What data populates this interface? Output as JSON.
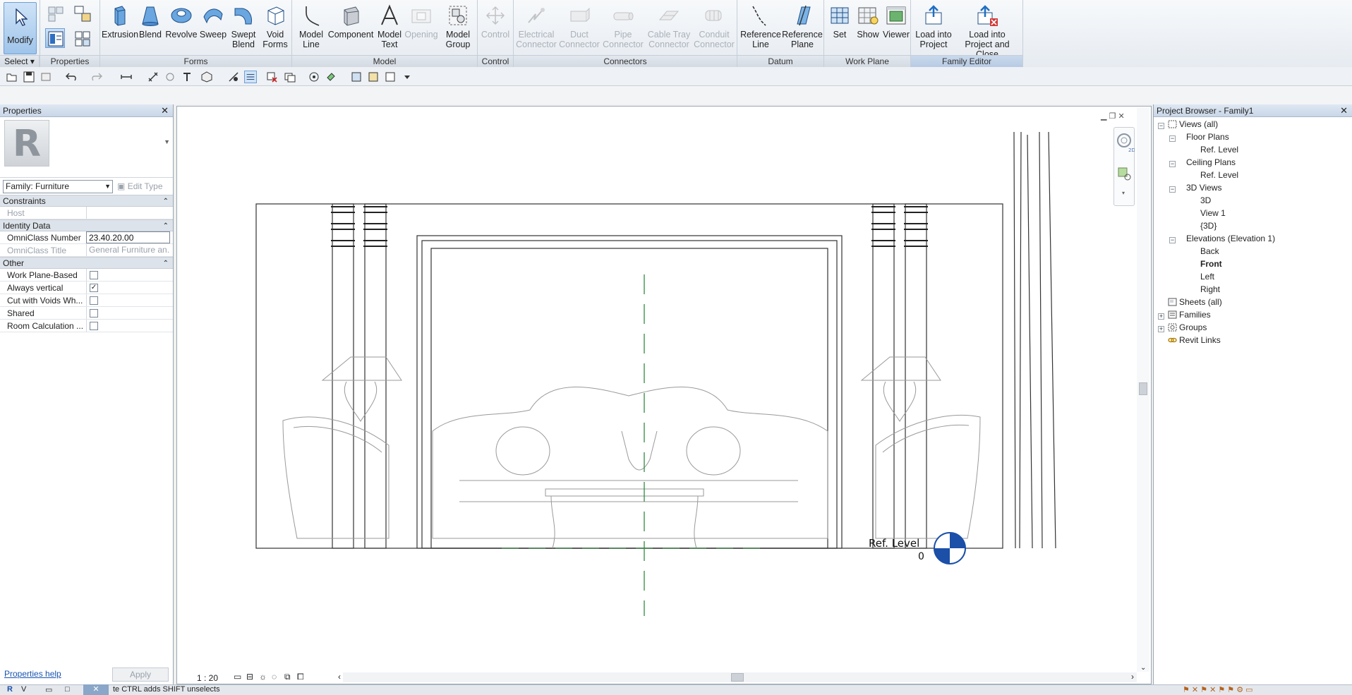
{
  "ribbon": {
    "modify_label": "Modify",
    "select_label": "Select",
    "groups": {
      "properties": "Properties",
      "forms": "Forms",
      "model": "Model",
      "control": "Control",
      "connectors": "Connectors",
      "datum": "Datum",
      "work_plane": "Work Plane",
      "family_editor": "Family Editor"
    },
    "buttons": {
      "extrusion": "Extrusion",
      "blend": "Blend",
      "revolve": "Revolve",
      "sweep": "Sweep",
      "swept_blend": "Swept\nBlend",
      "void_forms": "Void\nForms",
      "model_line": "Model\nLine",
      "component": "Component",
      "model_text": "Model\nText",
      "opening": "Opening",
      "model_group": "Model\nGroup",
      "control": "Control",
      "electrical_connector": "Electrical\nConnector",
      "duct_connector": "Duct\nConnector",
      "pipe_connector": "Pipe\nConnector",
      "cable_tray_connector": "Cable Tray\nConnector",
      "conduit_connector": "Conduit\nConnector",
      "reference_line": "Reference\nLine",
      "reference_plane": "Reference\nPlane",
      "set": "Set",
      "show": "Show",
      "viewer": "Viewer",
      "load_into_project": "Load into\nProject",
      "load_into_project_close": "Load into\nProject and Close"
    }
  },
  "properties": {
    "title": "Properties",
    "family_select": "Family: Furniture",
    "edit_type": "Edit Type",
    "sections": {
      "constraints": "Constraints",
      "identity": "Identity Data",
      "other": "Other"
    },
    "host_label": "Host",
    "host_value": "",
    "omniclass_number_label": "OmniClass Number",
    "omniclass_number_value": "23.40.20.00",
    "omniclass_title_label": "OmniClass Title",
    "omniclass_title_value": "General Furniture an...",
    "other_rows": [
      {
        "label": "Work Plane-Based",
        "checked": false
      },
      {
        "label": "Always vertical",
        "checked": true
      },
      {
        "label": "Cut with Voids Wh...",
        "checked": false
      },
      {
        "label": "Shared",
        "checked": false
      },
      {
        "label": "Room Calculation ...",
        "checked": false
      }
    ],
    "help_link": "Properties help",
    "apply": "Apply"
  },
  "canvas": {
    "level_label": "Ref. Level",
    "level_value": "0",
    "scale": "1 : 20"
  },
  "browser": {
    "title": "Project Browser - Family1",
    "items": {
      "views_all": "Views (all)",
      "floor_plans": "Floor Plans",
      "fp_ref_level": "Ref. Level",
      "ceiling_plans": "Ceiling Plans",
      "cp_ref_level": "Ref. Level",
      "views_3d": "3D Views",
      "v3d": "3D",
      "view1": "View 1",
      "v3d_brace": "{3D}",
      "elevations": "Elevations (Elevation 1)",
      "back": "Back",
      "front": "Front",
      "left": "Left",
      "right": "Right",
      "sheets": "Sheets (all)",
      "families": "Families",
      "groups": "Groups",
      "revit_links": "Revit Links"
    }
  },
  "status": {
    "text": "te CTRL adds SHIFT unselects"
  },
  "colors": {
    "accent": "#9fc4ea",
    "ref_plane": "#2e8b3e",
    "level_marker": "#1b4fa8"
  }
}
